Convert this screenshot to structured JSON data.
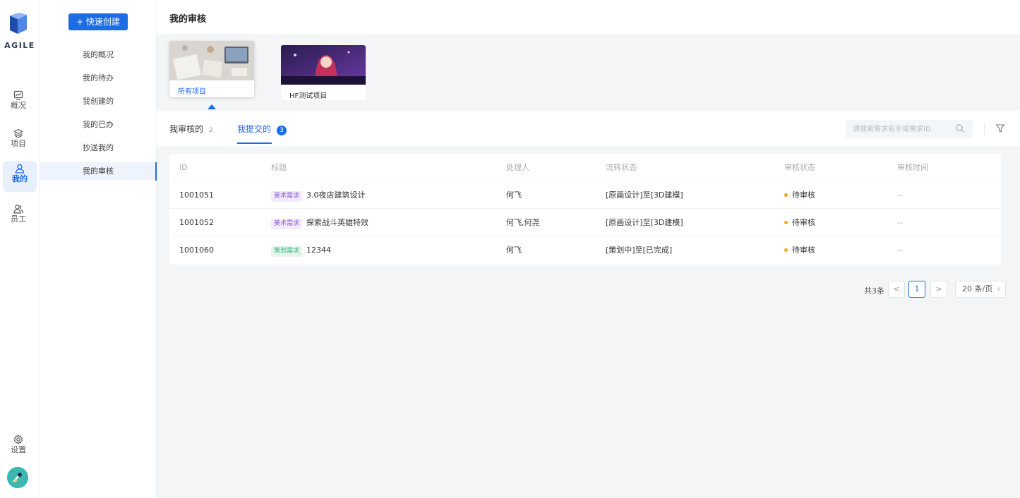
{
  "brand": {
    "name": "AGILE",
    "accent": "#1e6be6"
  },
  "rail": {
    "items": [
      {
        "label": "概况",
        "icon": "chart-icon"
      },
      {
        "label": "项目",
        "icon": "layers-icon"
      },
      {
        "label": "我的",
        "icon": "user-icon",
        "active": true
      },
      {
        "label": "员工",
        "icon": "users-icon"
      }
    ],
    "settings_label": "设置"
  },
  "subnav": {
    "create_label": "+ 快速创建",
    "items": [
      "我的概况",
      "我的待办",
      "我创建的",
      "我的已办",
      "抄送我的",
      "我的审核"
    ],
    "active_index": 5
  },
  "page": {
    "title": "我的审核"
  },
  "projects": [
    {
      "label": "所有项目",
      "active": true
    },
    {
      "label": "HF测试项目",
      "active": false
    }
  ],
  "tabs": [
    {
      "label": "我审核的",
      "count": "2"
    },
    {
      "label": "我提交的",
      "count": "3",
      "active": true
    }
  ],
  "search": {
    "placeholder": "请搜索需求名字或需求ID"
  },
  "table": {
    "headers": [
      "ID",
      "标题",
      "处理人",
      "流转状态",
      "审核状态",
      "审核时间"
    ],
    "rows": [
      {
        "id": "1001051",
        "tag": "美术需求",
        "tag_color": "#8e5bd8",
        "tag_bg": "#f2ebfc",
        "title": "3.0夜店建筑设计",
        "assignee": "何飞",
        "flow": "[原画设计]至[3D建模]",
        "status": "待审核",
        "status_color": "#f5a623",
        "time": "--"
      },
      {
        "id": "1001052",
        "tag": "美术需求",
        "tag_color": "#8e5bd8",
        "tag_bg": "#f2ebfc",
        "title": "探索战斗英雄特效",
        "assignee": "何飞,何尧",
        "flow": "[原画设计]至[3D建模]",
        "status": "待审核",
        "status_color": "#f5a623",
        "time": "--"
      },
      {
        "id": "1001060",
        "tag": "策划需求",
        "tag_color": "#36b37e",
        "tag_bg": "#e6f6ee",
        "title": "12344",
        "assignee": "何飞",
        "flow": "[策划中]至[已完成]",
        "status": "待审核",
        "status_color": "#f5a623",
        "time": "--"
      }
    ]
  },
  "pagination": {
    "total": "共3条",
    "prev": "<",
    "current": "1",
    "next": ">",
    "page_size": "20 条/页"
  }
}
